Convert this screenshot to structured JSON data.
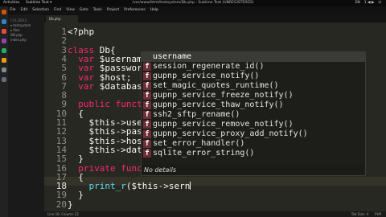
{
  "topbar": {
    "activities": "Activities",
    "app": "Sublime Text ▾",
    "title": "/var/www/html/testsystem/Db.php - Sublime Text (UNREGISTERED)",
    "tray": [
      "EN",
      "1 ◀ ▶",
      "⏻"
    ]
  },
  "menubar": {
    "items": [
      "File",
      "Edit",
      "Selection",
      "Find",
      "View",
      "Goto",
      "Tools",
      "Project",
      "Preferences",
      "Help"
    ]
  },
  "sidebar": {
    "heading": "FOLDERS",
    "rows": [
      "▾ testsystem",
      "  ▸ files",
      "    DB.php",
      "    index.php"
    ]
  },
  "tab": {
    "label": "Db.php"
  },
  "editor": {
    "line_numbers": [
      "1",
      "2",
      "3",
      "4",
      "5",
      "6",
      "7",
      "8",
      "9",
      "10",
      "11",
      "12",
      "13",
      "14",
      "15",
      "16",
      "17",
      "18",
      "19",
      "20"
    ],
    "active_line": "18"
  },
  "autocomplete": {
    "items": [
      "username",
      "session_regenerate_id()",
      "gupnp_service_notify()",
      "set_magic_quotes_runtime()",
      "gupnp_service_freeze_notify()",
      "gupnp_service_thaw_notify()",
      "ssh2_sftp_rename()",
      "gupnp_service_remove_notify()",
      "gupnp_service_proxy_add_notify()",
      "set_error_handler()",
      "sqlite_error_string()"
    ],
    "badge": "f",
    "footer": "No details"
  },
  "statusbar": {
    "left": "Line 18, Column 22",
    "right": [
      "Tab Size: 4",
      "PHP"
    ]
  },
  "colors": {
    "editor_bg": "#272822",
    "keyword": "#f92672",
    "function": "#66d9ef",
    "badge": "#6e2e35"
  }
}
